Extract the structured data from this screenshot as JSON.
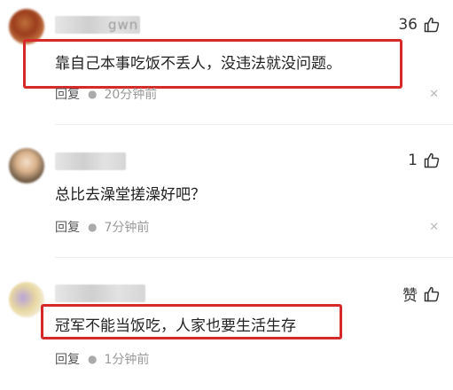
{
  "comments": [
    {
      "username": "gwn",
      "likes": "36",
      "text": "靠自己本事吃饭不丢人，没违法就没问题。",
      "reply_label": "回复",
      "time": "20分钟前"
    },
    {
      "username": "",
      "likes": "1",
      "text": "总比去澡堂搓澡好吧？",
      "reply_label": "回复",
      "time": "7分钟前"
    },
    {
      "username": "",
      "likes": "赞",
      "text": "冠军不能当饭吃，人家也要生活生存",
      "reply_label": "回复",
      "time": "1分钟前"
    }
  ],
  "icons": {
    "like": "thumbs-up-icon",
    "close": "close-icon"
  },
  "colors": {
    "highlight": "#d62a2a"
  }
}
